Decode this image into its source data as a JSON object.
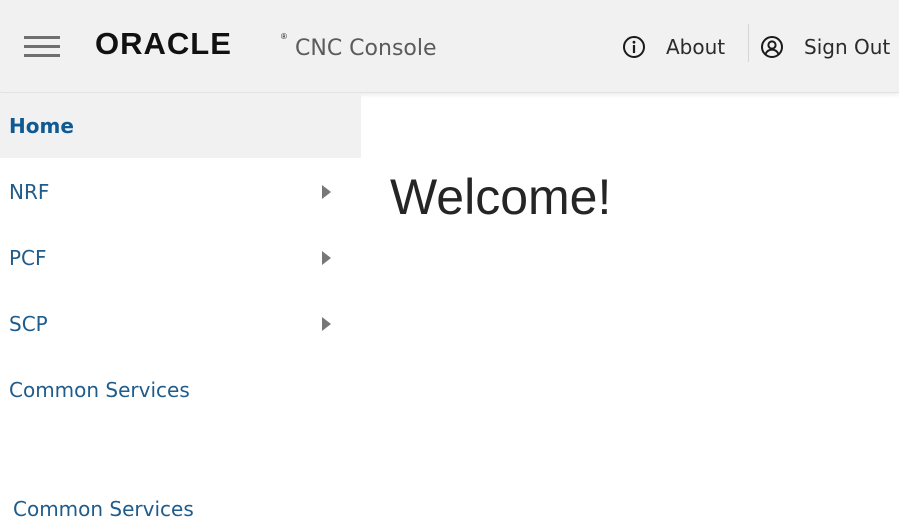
{
  "header": {
    "brand": "ORACLE",
    "app_title": "CNC Console",
    "about_label": "About",
    "signout_label": "Sign Out"
  },
  "sidebar": {
    "items": [
      {
        "label": "Home",
        "active": true,
        "has_submenu": false
      },
      {
        "label": "NRF",
        "active": false,
        "has_submenu": true
      },
      {
        "label": "PCF",
        "active": false,
        "has_submenu": true
      },
      {
        "label": "SCP",
        "active": false,
        "has_submenu": true
      },
      {
        "label": "Common Services",
        "active": false,
        "has_submenu": false
      }
    ],
    "footer_link": "Common Services"
  },
  "main": {
    "welcome": "Welcome!"
  },
  "colors": {
    "header_bg": "#f1f1f1",
    "link": "#1f5c8c",
    "active_link": "#0f5a93",
    "active_bg": "#f1f1f1"
  },
  "icons": {
    "menu": "hamburger-menu-icon",
    "about": "info-circle-icon",
    "signout": "user-circle-icon",
    "submenu": "caret-right-icon"
  }
}
